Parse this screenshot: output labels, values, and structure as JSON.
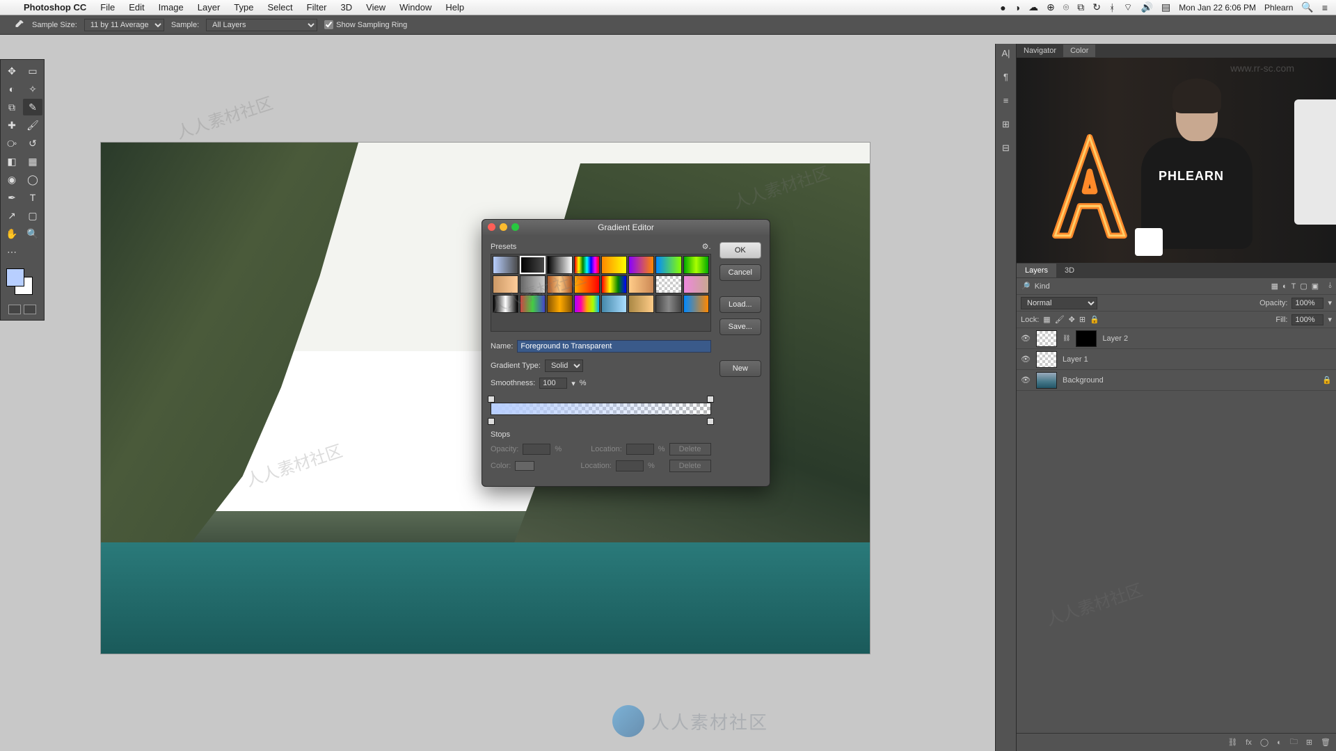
{
  "menubar": {
    "apple": "",
    "app": "Photoshop CC",
    "items": [
      "File",
      "Edit",
      "Image",
      "Layer",
      "Type",
      "Select",
      "Filter",
      "3D",
      "View",
      "Window",
      "Help"
    ],
    "clock": "Mon Jan 22  6:06 PM",
    "user": "Phlearn"
  },
  "options": {
    "sample_size_label": "Sample Size:",
    "sample_size_value": "11 by 11 Average",
    "sample_label": "Sample:",
    "sample_value": "All Layers",
    "show_ring": "Show Sampling Ring"
  },
  "nav_tabs": {
    "navigator": "Navigator",
    "color": "Color"
  },
  "video": {
    "shirt": "PHLEARN"
  },
  "layers": {
    "tab_layers": "Layers",
    "tab_3d": "3D",
    "kind_label": "Kind",
    "blend": "Normal",
    "opacity_label": "Opacity:",
    "opacity_val": "100%",
    "lock_label": "Lock:",
    "fill_label": "Fill:",
    "fill_val": "100%",
    "items": [
      {
        "name": "Layer 2",
        "has_mask": true
      },
      {
        "name": "Layer 1",
        "has_mask": false
      },
      {
        "name": "Background",
        "locked": true
      }
    ]
  },
  "dialog": {
    "title": "Gradient Editor",
    "presets_label": "Presets",
    "ok": "OK",
    "cancel": "Cancel",
    "load": "Load...",
    "save": "Save...",
    "new": "New",
    "name_label": "Name:",
    "name_value": "Foreground to Transparent",
    "type_label": "Gradient Type:",
    "type_value": "Solid",
    "smooth_label": "Smoothness:",
    "smooth_value": "100",
    "pct": "%",
    "stops_label": "Stops",
    "opacity_label": "Opacity:",
    "location_label": "Location:",
    "color_label": "Color:",
    "delete": "Delete",
    "presets": [
      "linear-gradient(90deg,#b8cfff,rgba(184,207,255,0))",
      "linear-gradient(90deg,#000,rgba(0,0,0,0))",
      "linear-gradient(90deg,#000,#fff)",
      "linear-gradient(90deg,red,yellow,green,cyan,blue,magenta,red)",
      "linear-gradient(90deg,#f80,#ff0)",
      "linear-gradient(90deg,#80f,#f80)",
      "linear-gradient(90deg,#08f,#8f0)",
      "linear-gradient(90deg,#0a0,#af0,#0a0)",
      "linear-gradient(90deg,#c96,#fc9)",
      "linear-gradient(90deg,#666,#ccc)",
      "linear-gradient(90deg,#a52,#fc8,#a52)",
      "linear-gradient(90deg,#fa0,#f00)",
      "linear-gradient(90deg,red,yellow,green,blue)",
      "linear-gradient(90deg,#fc8,#c85)",
      "repeating-conic-gradient(#ccc 0 25%,#fff 0 50%)",
      "linear-gradient(90deg,#e8d,#c8a890)",
      "linear-gradient(90deg,#000,#fff,#000)",
      "linear-gradient(90deg,#c44,#4c4,#44c)",
      "linear-gradient(90deg,#850,#fa0,#850)",
      "linear-gradient(90deg,#a0f,#f0a,#fa0,#af0,#0af)",
      "linear-gradient(90deg,#48a,#adf)",
      "linear-gradient(90deg,#a84,#fc8)",
      "linear-gradient(90deg,#444,#888,#444)",
      "linear-gradient(90deg,#08f,#f80)"
    ]
  },
  "watermark_site": "www.rr-sc.com",
  "logo_text": "人人素材社区"
}
